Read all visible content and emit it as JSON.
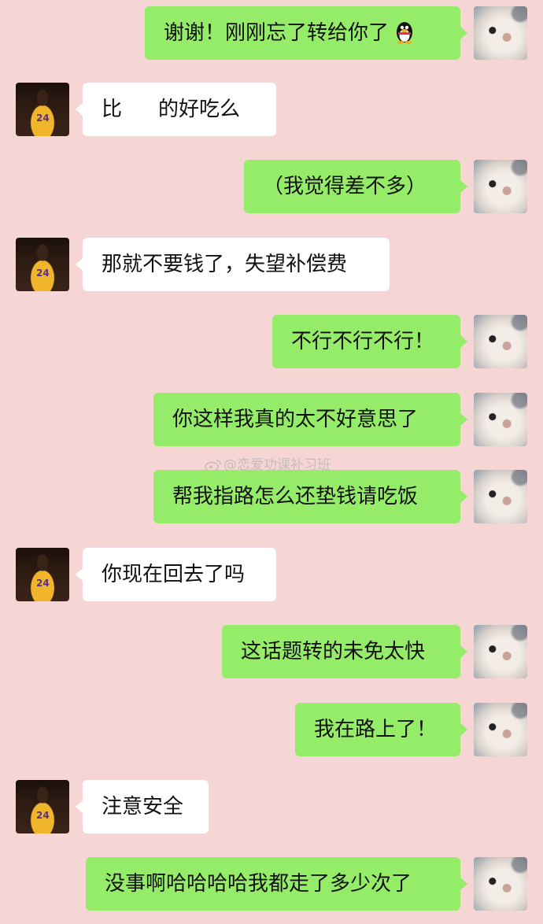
{
  "messages": [
    {
      "side": "right",
      "text": "谢谢！刚刚忘了转给你了",
      "emoji": "qq-penguin-icon"
    },
    {
      "side": "left",
      "parts": [
        "比",
        "的好吃么"
      ]
    },
    {
      "side": "right",
      "text": "（我觉得差不多）"
    },
    {
      "side": "left",
      "text": "那就不要钱了，失望补偿费"
    },
    {
      "side": "right",
      "text": "不行不行不行！"
    },
    {
      "side": "right",
      "text": "你这样我真的太不好意思了"
    },
    {
      "side": "right",
      "text": "帮我指路怎么还垫钱请吃饭"
    },
    {
      "side": "left",
      "text": "你现在回去了吗"
    },
    {
      "side": "right",
      "text": "这话题转的未免太快"
    },
    {
      "side": "right",
      "text": "我在路上了！"
    },
    {
      "side": "left",
      "text": "注意安全"
    },
    {
      "side": "right",
      "text": "没事啊哈哈哈哈我都走了多少次了"
    }
  ],
  "watermark": "@恋爱功课补习班",
  "colors": {
    "background": "#f6d5d5",
    "sent_bubble": "#95ec69",
    "received_bubble": "#ffffff"
  }
}
